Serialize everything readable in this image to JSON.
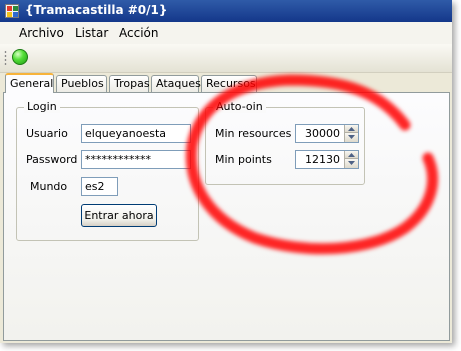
{
  "window": {
    "title": "{Tramacastilla #0/1}"
  },
  "menu": [
    {
      "label": "Archivo"
    },
    {
      "label": "Listar"
    },
    {
      "label": "Acción"
    }
  ],
  "toolbar": {
    "status_icon": "green-light-icon",
    "status_color": "#3fcf2a"
  },
  "tabs": [
    {
      "label": "General",
      "active": true
    },
    {
      "label": "Pueblos"
    },
    {
      "label": "Tropas"
    },
    {
      "label": "Ataques"
    },
    {
      "label": "Recursos"
    }
  ],
  "login": {
    "legend": "Login",
    "usuario_label": "Usuario",
    "usuario_value": "elqueyanoesta",
    "password_label": "Password",
    "password_value": "************",
    "mundo_label": "Mundo",
    "mundo_value": "es2",
    "submit_label": "Entrar ahora"
  },
  "autojoin": {
    "legend": "Auto-oin",
    "min_resources_label": "Min resources",
    "min_resources_value": "30000",
    "min_points_label": "Min points",
    "min_points_value": "12130"
  },
  "colors": {
    "annotation_red": "#ff0000",
    "titlebar": "#1f47a0"
  }
}
